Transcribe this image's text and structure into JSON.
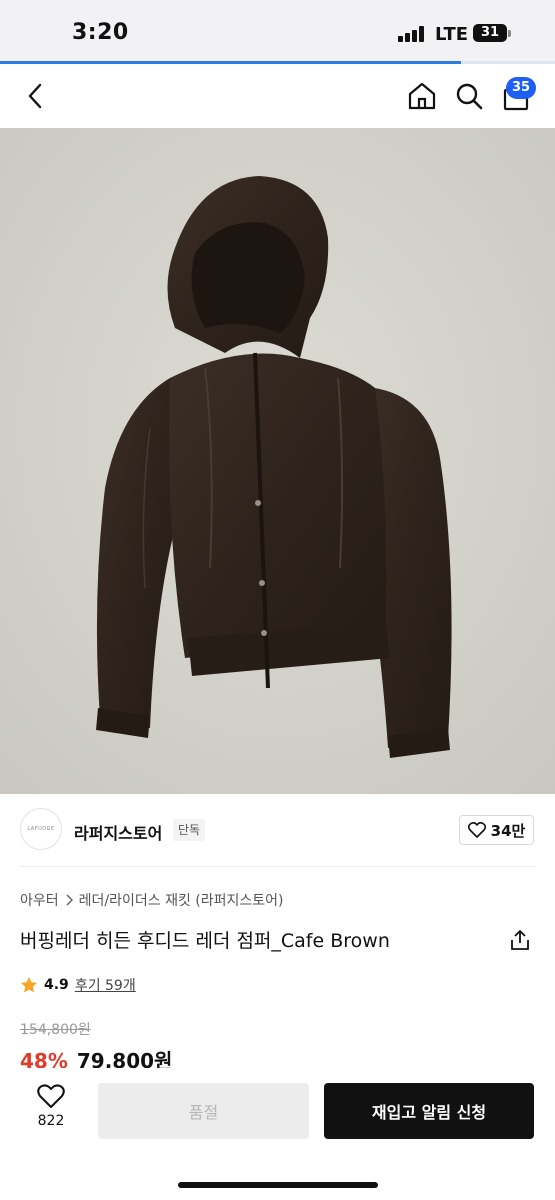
{
  "status_bar": {
    "time": "3:20",
    "network": "LTE",
    "battery": "31",
    "page_load_progress": 0.83
  },
  "nav": {
    "back_icon": "chevron-left-icon",
    "home_icon": "home-icon",
    "search_icon": "search-icon",
    "cart_icon": "shopping-bag-icon",
    "cart_count": "35"
  },
  "hero": {
    "image": "dark brown leather hooded bomber jacket on grey background",
    "background_color": "#d3d2cb",
    "jacket_color": "#2f241d"
  },
  "store": {
    "logo_text": "LAFUDGE",
    "name": "라퍼지스토어",
    "badge": "단독",
    "like_count": "34만"
  },
  "product": {
    "breadcrumb": [
      "아우터",
      "레더/라이더스 재킷 (라퍼지스토어)"
    ],
    "title": "버핑레더 히든 후디드 레더 점퍼_Cafe Brown",
    "rating": "4.9",
    "review_link": "후기 59개",
    "original_price": "154,800원",
    "discount": "48%",
    "sale_price": "79,800원"
  },
  "actions": {
    "wishlist_count": "822",
    "soldout_label": "품절",
    "restock_label": "재입고 알림 신청"
  },
  "colors": {
    "accent_blue": "#1e5ff5",
    "discount_red": "#e23b2b",
    "star_orange": "#f6a623"
  }
}
